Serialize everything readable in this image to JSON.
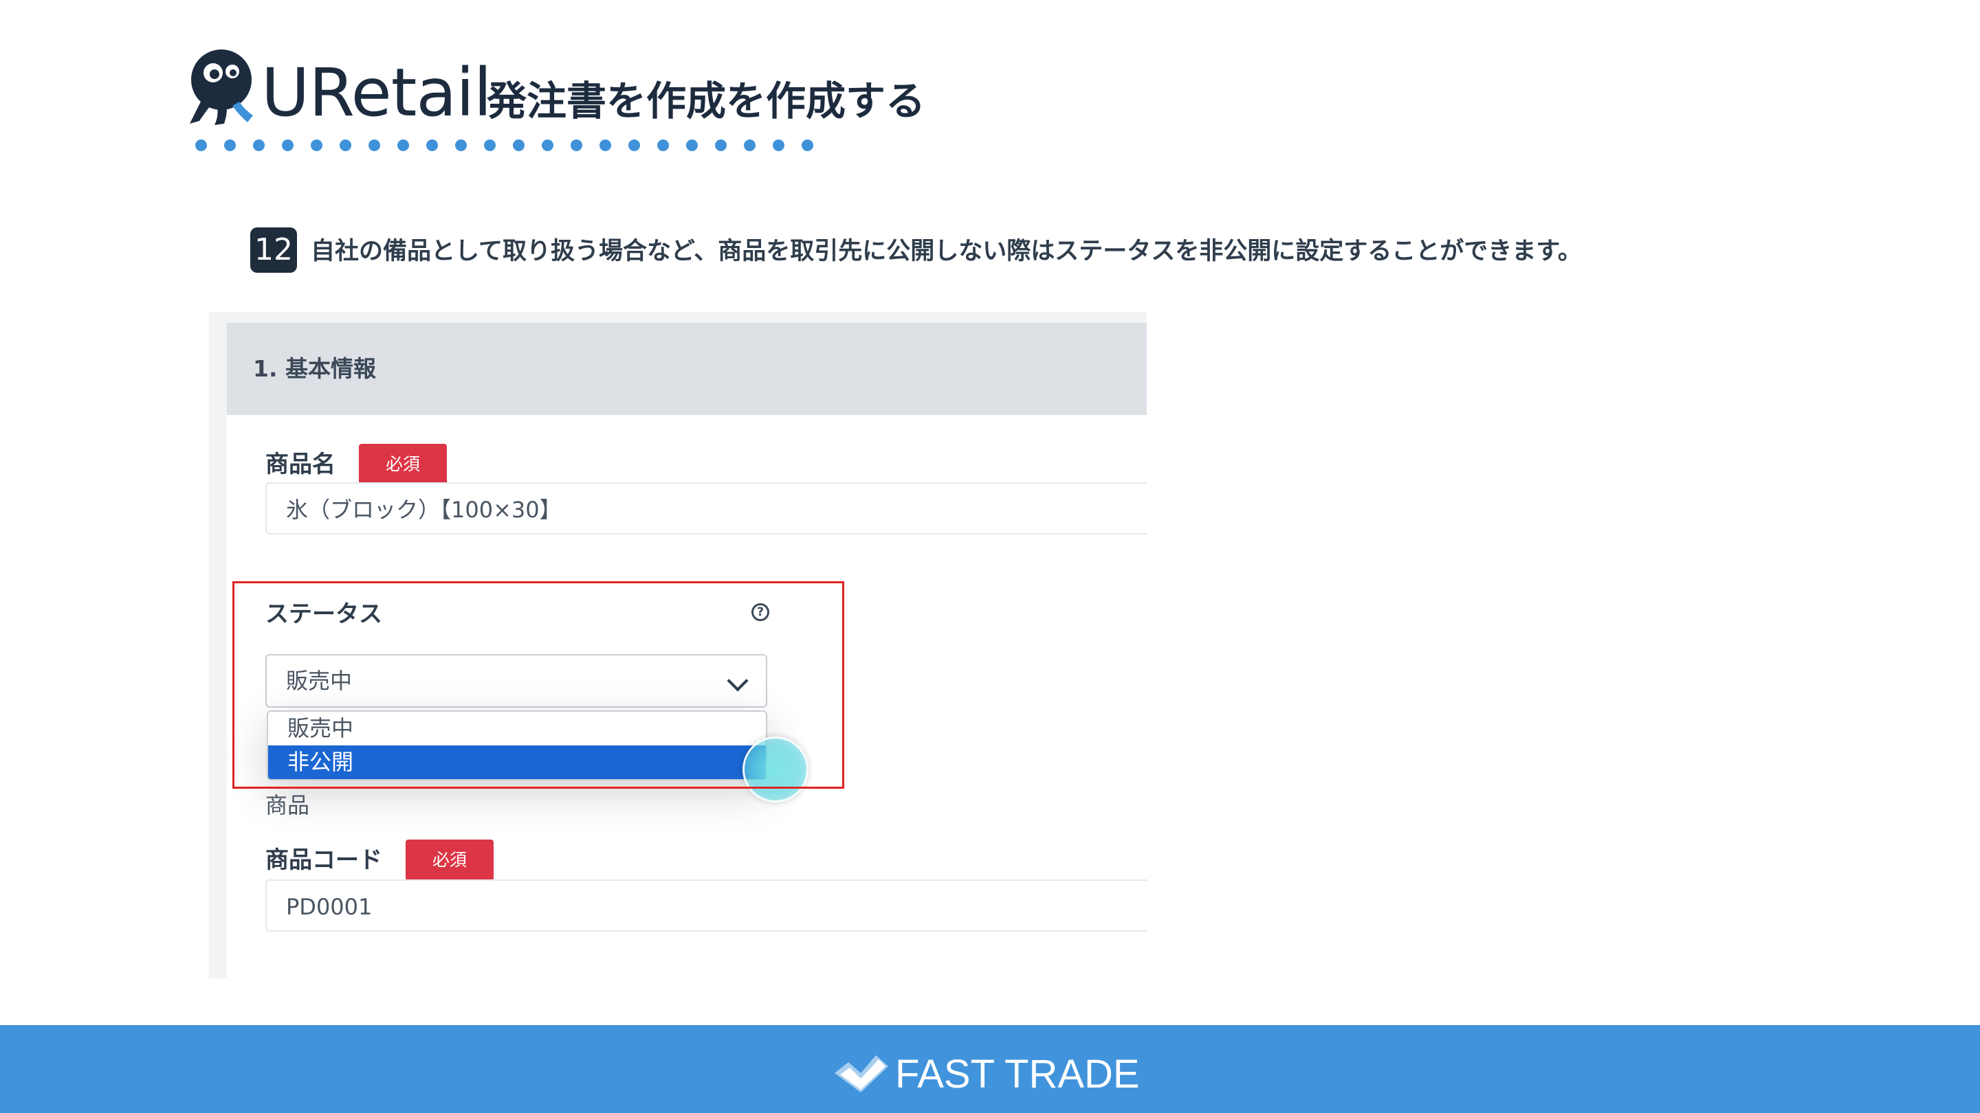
{
  "header": {
    "brand": "URetail",
    "trademark": "™",
    "page_title": "発注書を作成を作成する"
  },
  "step": {
    "number": "12",
    "text": "自社の備品として取り扱う場合など、商品を取引先に公開しない際はステータスを非公開に設定することができます。"
  },
  "form": {
    "section_title": "1. 基本情報",
    "product_name_label": "商品名",
    "required_label": "必須",
    "product_name_value": "氷（ブロック）【100×30】",
    "status_label": "ステータス",
    "help_symbol": "?",
    "status_selected": "販売中",
    "status_options": [
      "販売中",
      "非公開"
    ],
    "partial_text_below": "商品",
    "product_code_label": "商品コード",
    "product_code_value": "PD0001"
  },
  "footer": {
    "brand": "FAST TRADE"
  },
  "colors": {
    "brand_blue": "#4194dc",
    "required_red": "#dc3545",
    "selected_option": "#1a66d2",
    "highlight_border": "#e02424"
  },
  "icons": {
    "logo": "octopus-logo-icon",
    "help": "question-circle-icon",
    "select_arrow": "chevron-down-icon",
    "footer_logo": "fast-trade-check-icon"
  }
}
